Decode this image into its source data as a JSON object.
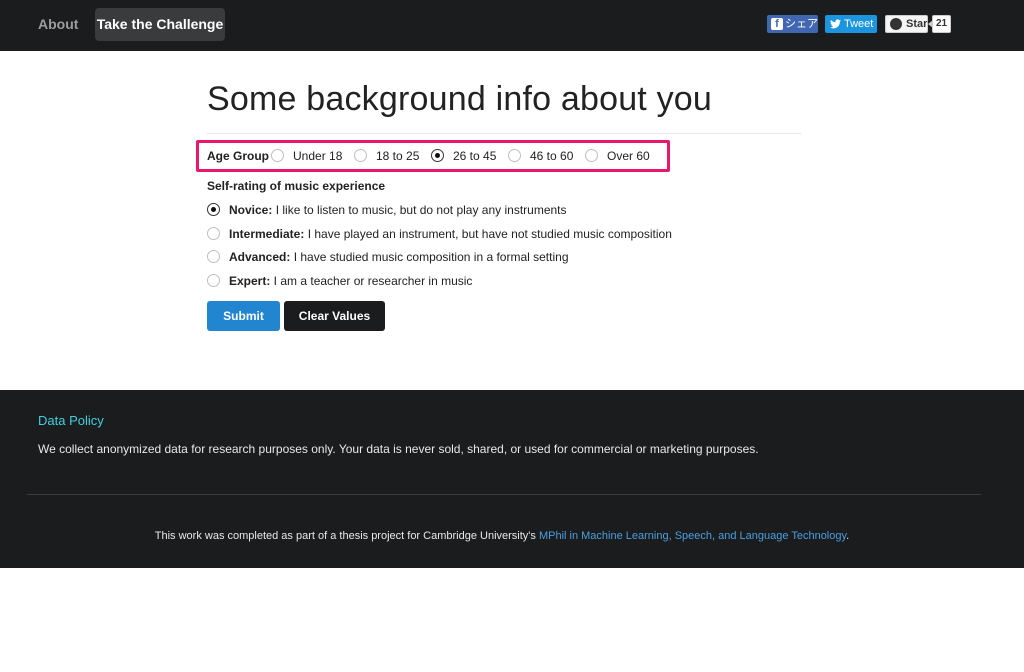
{
  "navbar": {
    "about": "About",
    "challenge": "Take the Challenge",
    "share": "シェア",
    "tweet": "Tweet",
    "star": "Star",
    "star_count": "21"
  },
  "main": {
    "title": "Some background info about you",
    "age_group": {
      "label": "Age Group",
      "options": [
        "Under 18",
        "18 to 25",
        "26 to 45",
        "46 to 60",
        "Over 60"
      ],
      "selected": "26 to 45"
    },
    "experience": {
      "heading": "Self-rating of music experience",
      "options": [
        {
          "level": "Novice:",
          "desc": " I like to listen to music, but do not play any instruments"
        },
        {
          "level": "Intermediate:",
          "desc": " I have played an instrument, but have not studied music composition"
        },
        {
          "level": "Advanced:",
          "desc": " I have studied music composition in a formal setting"
        },
        {
          "level": "Expert:",
          "desc": " I am a teacher or researcher in music"
        }
      ],
      "selected": "Novice:"
    },
    "submit": "Submit",
    "clear": "Clear Values"
  },
  "footer": {
    "policy_title": "Data Policy",
    "policy_text": "We collect anonymized data for research purposes only. Your data is never sold, shared, or used for commercial or marketing purposes.",
    "credit_prefix": "This work was completed as part of a thesis project for Cambridge University's ",
    "credit_link": "MPhil in Machine Learning, Speech, and Language Technology",
    "credit_suffix": "."
  },
  "colors": {
    "navbar_bg": "#1b1c1e",
    "highlight_border": "#e8186d",
    "submit_bg": "#2185d0",
    "policy_title": "#3fd1e0",
    "link": "#4a9fe0"
  }
}
